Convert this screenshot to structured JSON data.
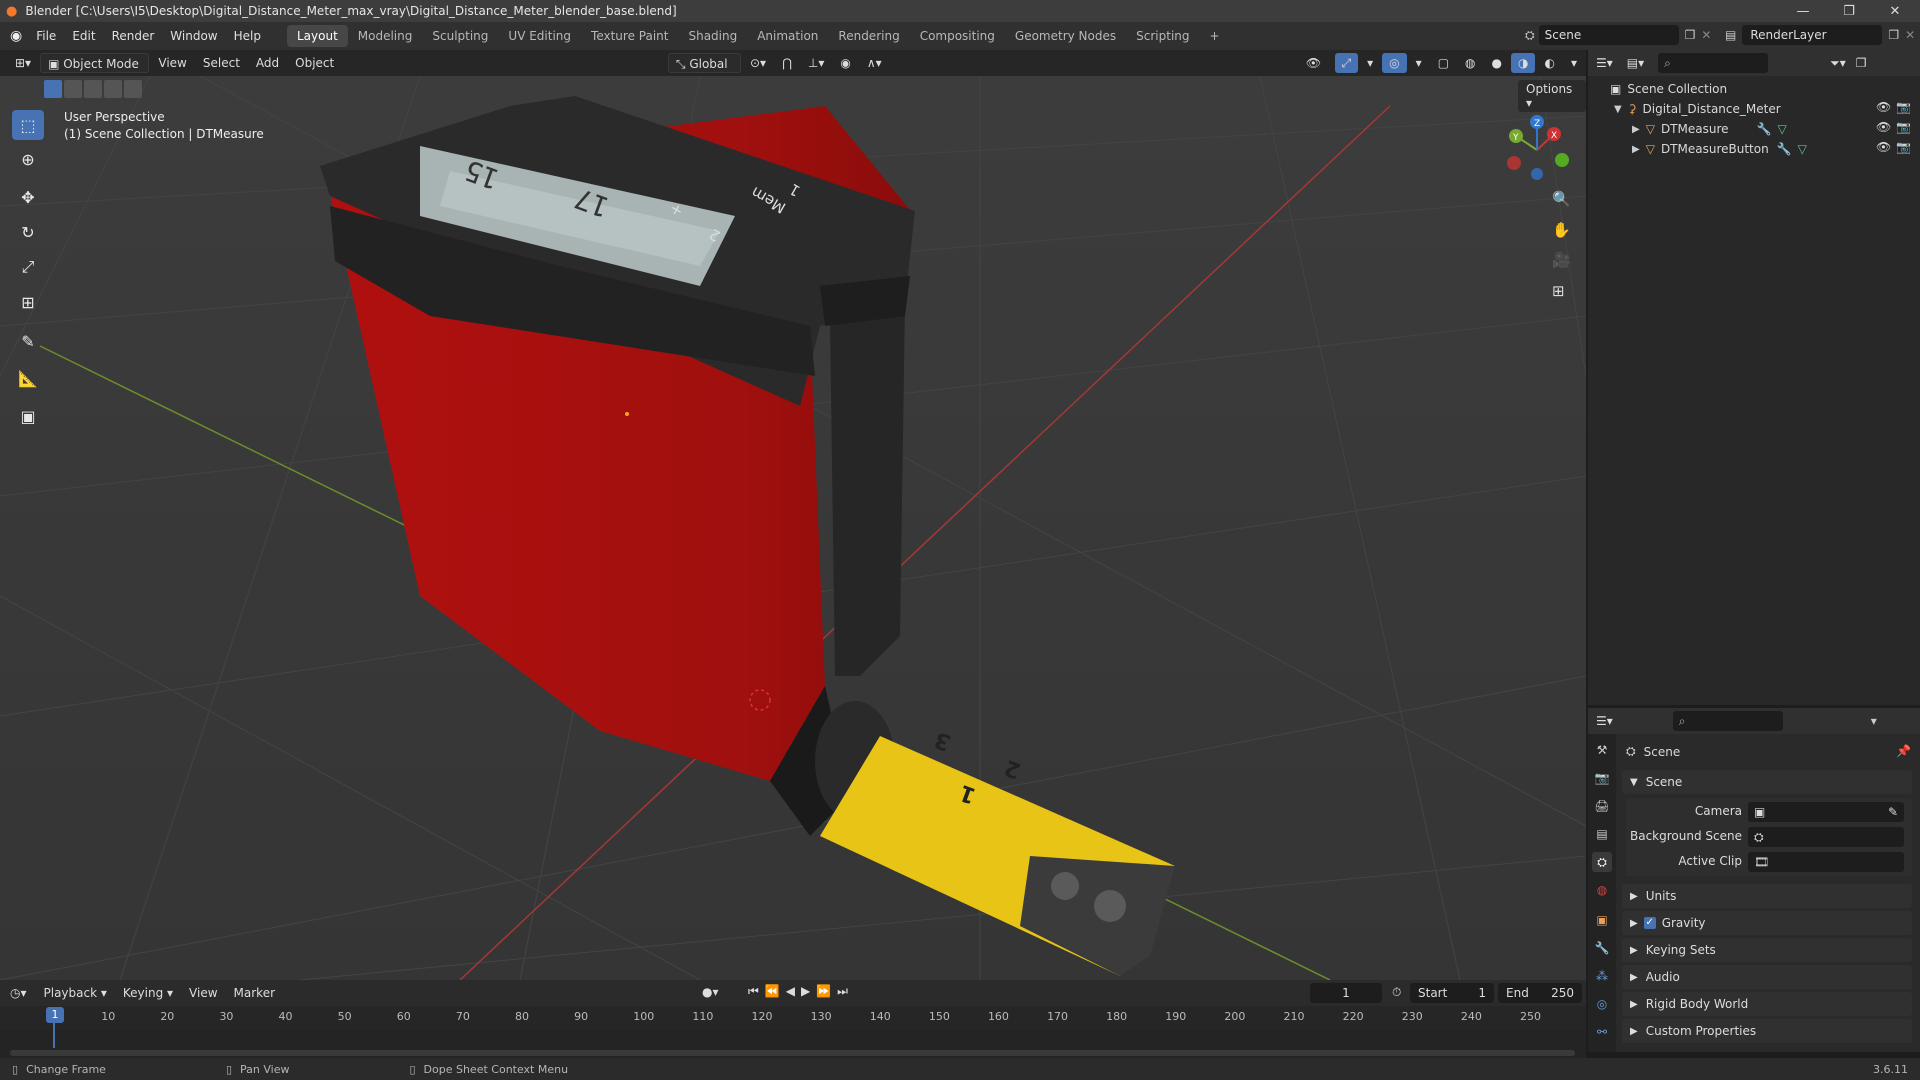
{
  "window": {
    "title": "Blender [C:\\Users\\I5\\Desktop\\Digital_Distance_Meter_max_vray\\Digital_Distance_Meter_blender_base.blend]"
  },
  "menu": [
    "File",
    "Edit",
    "Render",
    "Window",
    "Help"
  ],
  "workspaces": [
    "Layout",
    "Modeling",
    "Sculpting",
    "UV Editing",
    "Texture Paint",
    "Shading",
    "Animation",
    "Rendering",
    "Compositing",
    "Geometry Nodes",
    "Scripting"
  ],
  "active_workspace": "Layout",
  "scene_selector": "Scene",
  "renderlayer_selector": "RenderLayer",
  "viewport_header": {
    "mode": "Object Mode",
    "menus": [
      "View",
      "Select",
      "Add",
      "Object"
    ],
    "transform_orientation": "Global",
    "options": "Options"
  },
  "viewport": {
    "perspective_label": "User Perspective",
    "collection_label": "(1) Scene Collection | DTMeasure",
    "display_digits": [
      "15",
      "17"
    ],
    "buttons": [
      "Mem",
      "1",
      "2",
      "+"
    ],
    "tape_numbers": [
      "1",
      "2",
      "3"
    ]
  },
  "tools": [
    "select-box",
    "cursor",
    "move",
    "rotate",
    "scale",
    "transform",
    "annotate",
    "measure",
    "add-cube"
  ],
  "outliner": {
    "root": "Scene Collection",
    "collection": "Digital_Distance_Meter",
    "objects": [
      "DTMeasure",
      "DTMeasureButton"
    ]
  },
  "properties": {
    "context": "Scene",
    "panel": "Scene",
    "fields": [
      {
        "label": "Camera",
        "value": ""
      },
      {
        "label": "Background Scene",
        "value": ""
      },
      {
        "label": "Active Clip",
        "value": ""
      }
    ],
    "collapsed_panels": [
      "Units",
      "Gravity",
      "Keying Sets",
      "Audio",
      "Rigid Body World",
      "Custom Properties"
    ],
    "gravity_checked": true
  },
  "timeline": {
    "menus": [
      "Playback",
      "Keying",
      "View",
      "Marker"
    ],
    "current_frame": "1",
    "start_label": "Start",
    "start": "1",
    "end_label": "End",
    "end": "250",
    "ruler": [
      "1",
      "10",
      "20",
      "30",
      "40",
      "50",
      "60",
      "70",
      "80",
      "90",
      "100",
      "110",
      "120",
      "130",
      "140",
      "150",
      "160",
      "170",
      "180",
      "190",
      "200",
      "210",
      "220",
      "230",
      "240",
      "250"
    ]
  },
  "statusbar": {
    "items": [
      "Change Frame",
      "Pan View",
      "Dope Sheet Context Menu"
    ],
    "version": "3.6.11"
  }
}
